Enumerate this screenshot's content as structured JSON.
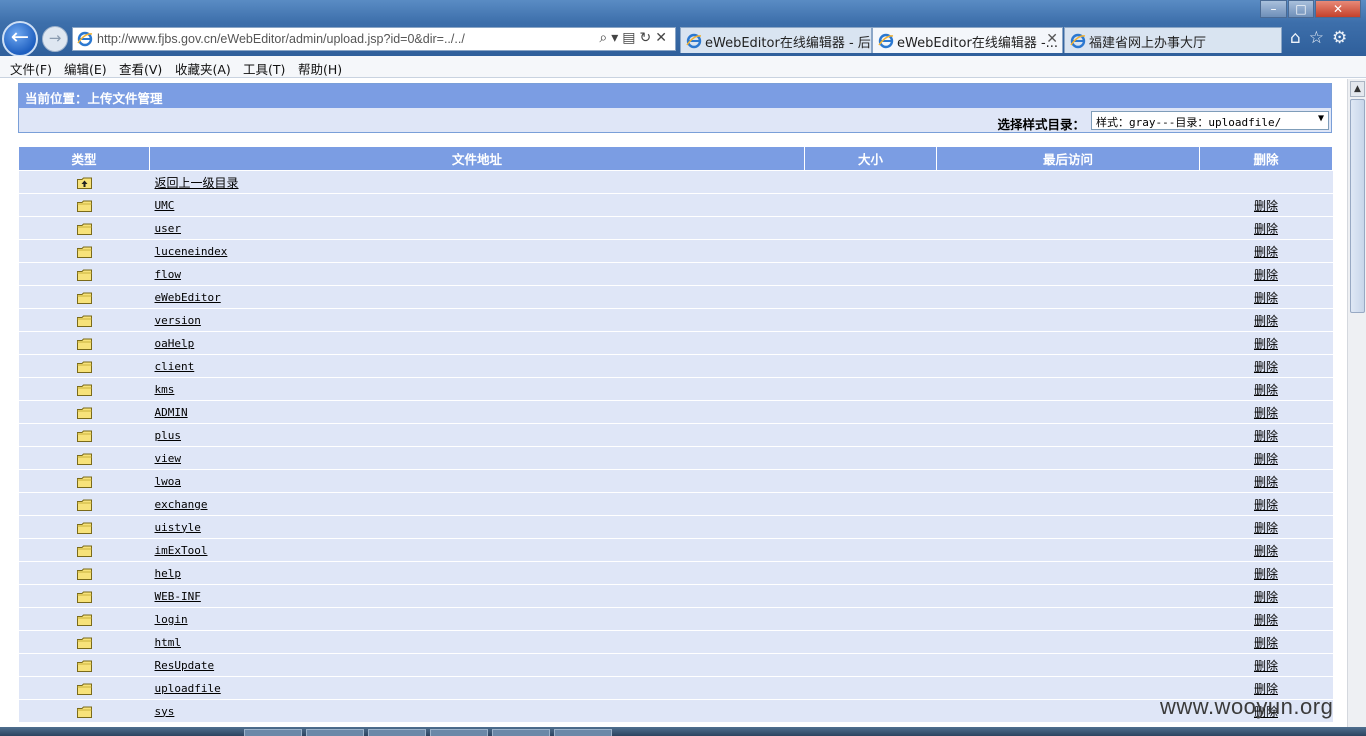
{
  "browser": {
    "url": "http://www.fjbs.gov.cn/eWebEditor/admin/upload.jsp?id=0&dir=../../",
    "tabs": [
      {
        "label": "eWebEditor在线编辑器 - 后..."
      },
      {
        "label": "eWebEditor在线编辑器 -..."
      },
      {
        "label": "福建省网上办事大厅"
      }
    ],
    "menu": [
      "文件(F)",
      "编辑(E)",
      "查看(V)",
      "收藏夹(A)",
      "工具(T)",
      "帮助(H)"
    ]
  },
  "page": {
    "location_title": "当前位置：上传文件管理",
    "style_label": "选择样式目录：",
    "style_select_value": "样式：gray---目录：uploadfile/",
    "columns": [
      "类型",
      "文件地址",
      "大小",
      "最后访问",
      "删除"
    ],
    "parent_link": "返回上一级目录",
    "delete_label": "删除",
    "folders": [
      "UMC",
      "user",
      "luceneindex",
      "flow",
      "eWebEditor",
      "version",
      "oaHelp",
      "client",
      "kms",
      "ADMIN",
      "plus",
      "view",
      "lwoa",
      "exchange",
      "uistyle",
      "imExTool",
      "help",
      "WEB-INF",
      "login",
      "html",
      "ResUpdate",
      "uploadfile",
      "sys"
    ]
  },
  "watermark": "www.wooyun.org",
  "colors": {
    "header_blue": "#7b9de3",
    "row_bg": "#dfe6f7"
  }
}
